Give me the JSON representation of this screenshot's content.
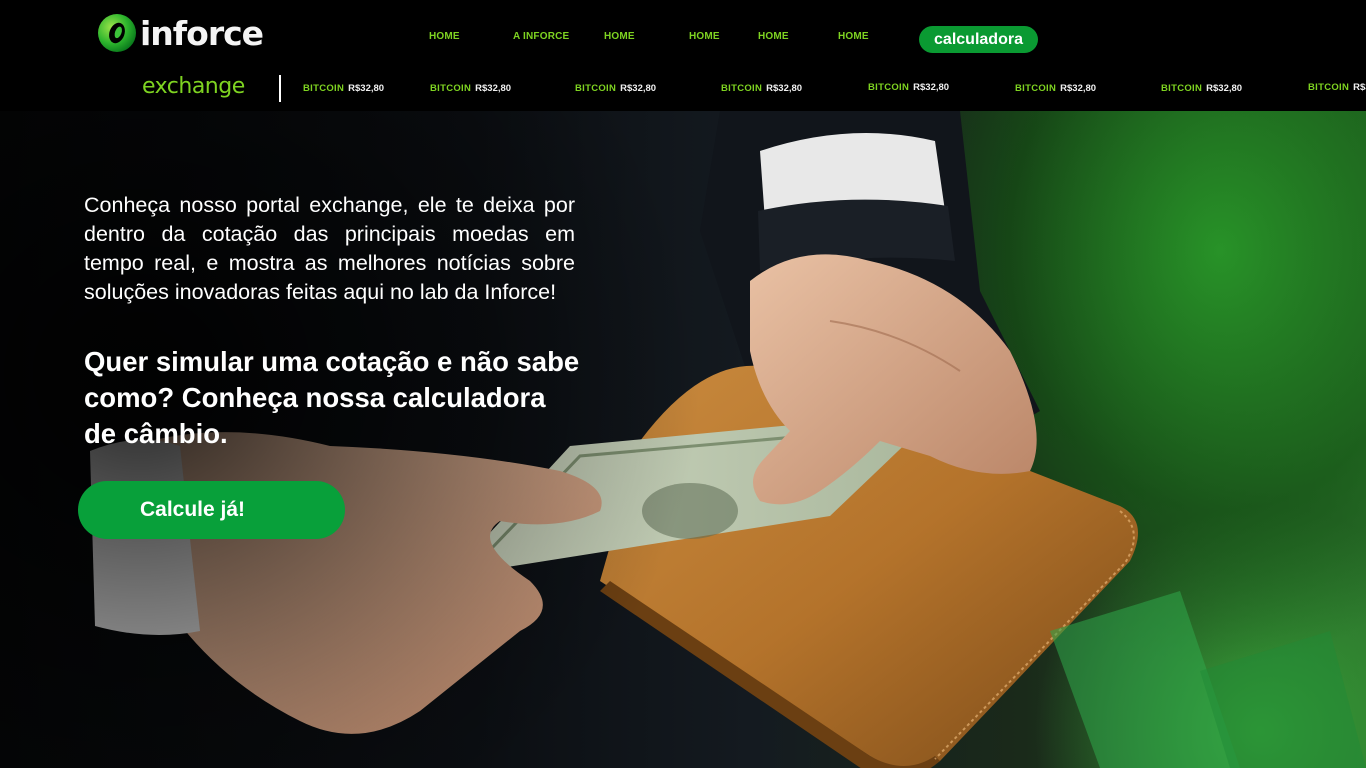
{
  "brand": {
    "name": "inforce",
    "accent": "#0a9a32",
    "accent_light": "#7ed321"
  },
  "nav": {
    "links": [
      "HOME",
      "A INFORCE",
      "HOME",
      "HOME",
      "HOME",
      "HOME"
    ],
    "cta": "calculadora"
  },
  "ticker": {
    "label": "exchange",
    "items": [
      {
        "symbol": "BITCOIN",
        "price": "R$32,80"
      },
      {
        "symbol": "BITCOIN",
        "price": "R$32,80"
      },
      {
        "symbol": "BITCOIN",
        "price": "R$32,80"
      },
      {
        "symbol": "BITCOIN",
        "price": "R$32,80"
      },
      {
        "symbol": "BITCOIN",
        "price": "R$32,80"
      },
      {
        "symbol": "BITCOIN",
        "price": "R$32,80"
      },
      {
        "symbol": "BITCOIN",
        "price": "R$32,80"
      },
      {
        "symbol": "BITCOIN",
        "price": "R$3"
      }
    ]
  },
  "hero": {
    "intro": "Conheça nosso portal exchange, ele te deixa por dentro da cotação das principais moedas em tempo real, e mostra as melhores notícias sobre soluções inovadoras feitas aqui no lab da Inforce!",
    "headline": "Quer simular uma cotação e não sabe como? Conheça nossa calculadora de câmbio.",
    "cta": "Calcule já!"
  }
}
